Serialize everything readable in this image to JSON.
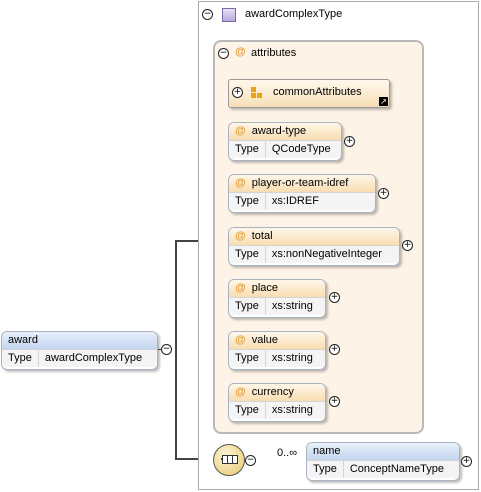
{
  "root": {
    "name": "award",
    "type_key": "Type",
    "type_value": "awardComplexType"
  },
  "complex_type": {
    "name": "awardComplexType"
  },
  "attributes_group": {
    "label": "attributes",
    "at_symbol": "@",
    "common": {
      "name": "commonAttributes"
    },
    "attributes": [
      {
        "name": "award-type",
        "type_key": "Type",
        "type_value": "QCodeType"
      },
      {
        "name": "player-or-team-idref",
        "type_key": "Type",
        "type_value": "xs:IDREF"
      },
      {
        "name": "total",
        "type_key": "Type",
        "type_value": "xs:nonNegativeInteger"
      },
      {
        "name": "place",
        "type_key": "Type",
        "type_value": "xs:string"
      },
      {
        "name": "value",
        "type_key": "Type",
        "type_value": "xs:string"
      },
      {
        "name": "currency",
        "type_key": "Type",
        "type_value": "xs:string"
      }
    ]
  },
  "sequence": {
    "cardinality": "0..∞"
  },
  "child": {
    "name": "name",
    "type_key": "Type",
    "type_value": "ConceptNameType"
  }
}
